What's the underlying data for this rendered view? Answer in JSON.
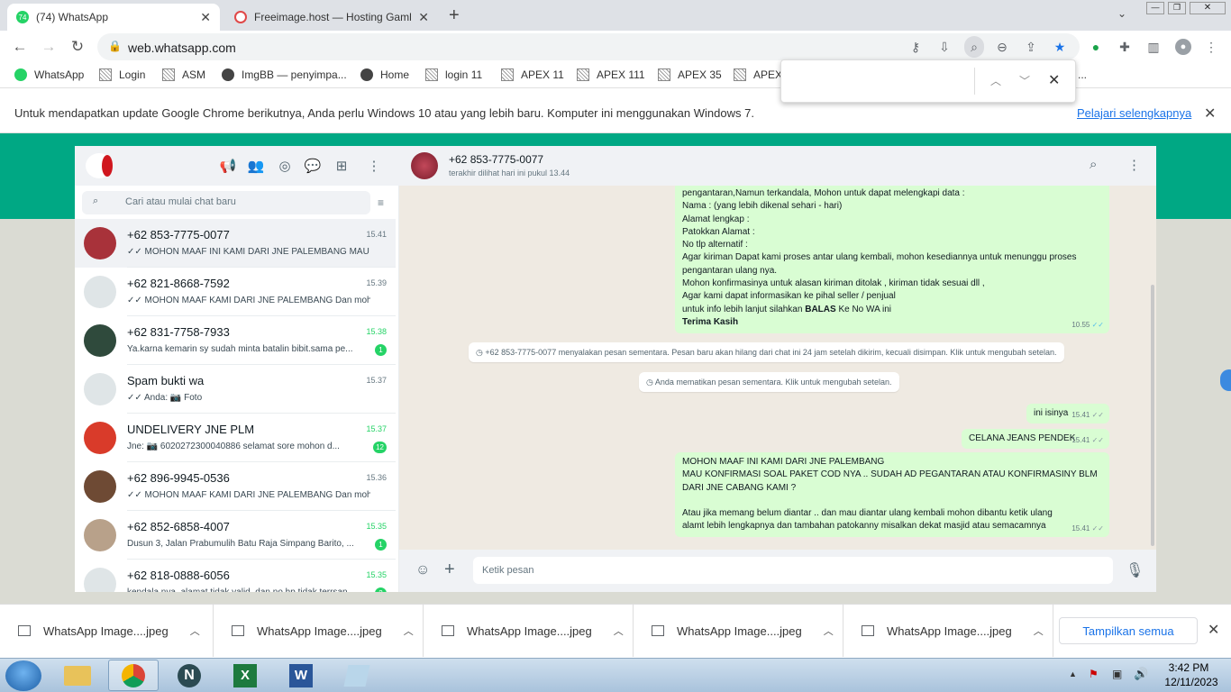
{
  "browser": {
    "tabs": [
      {
        "title": "(74) WhatsApp",
        "badge": "74"
      },
      {
        "title": "Freeimage.host — Hosting Gamb"
      }
    ],
    "url": "web.whatsapp.com",
    "bookmarks": [
      "WhatsApp",
      "Login",
      "ASM",
      "ImgBB — penyimpa...",
      "Home",
      "login 11",
      "APEX 11",
      "APEX 111",
      "APEX 35",
      "APEX"
    ],
    "bookmarks_more": "...",
    "infobar": {
      "message": "Untuk mendapatkan update Google Chrome berikutnya, Anda perlu Windows 10 atau yang lebih baru. Komputer ini menggunakan Windows 7.",
      "link": "Pelajari selengkapnya"
    }
  },
  "whatsapp": {
    "search_placeholder": "Cari atau mulai chat baru",
    "chats": [
      {
        "name": "+62 853-7775-0077",
        "time": "15.41",
        "preview": "✓✓ MOHON MAAF INI KAMI DARI JNE PALEMBANG MAU K...",
        "unread": "",
        "time_color": "#667781",
        "avatar": "#a8323a"
      },
      {
        "name": "+62 821-8668-7592",
        "time": "15.39",
        "preview": "✓✓ MOHON MAAF KAMI DARI JNE PALEMBANG   Dan moh...",
        "unread": "",
        "time_color": "#667781",
        "avatar": "#dfe5e7"
      },
      {
        "name": "+62 831-7758-7933",
        "time": "15.38",
        "preview": "Ya.karna kemarin sy sudah minta batalin bibit.sama pe...",
        "unread": "1",
        "time_color": "#25d366",
        "avatar": "#2f4a3c"
      },
      {
        "name": "Spam bukti wa",
        "time": "15.37",
        "preview": "✓✓ Anda: 📷 Foto",
        "unread": "",
        "time_color": "#667781",
        "avatar": "#dfe5e7"
      },
      {
        "name": "UNDELIVERY JNE PLM",
        "time": "15.37",
        "preview": "Jne: 📷 6020272300040886 selamat sore mohon d...",
        "unread": "12",
        "time_color": "#25d366",
        "avatar": "#d93b2a"
      },
      {
        "name": "+62 896-9945-0536",
        "time": "15.36",
        "preview": "✓✓ MOHON MAAF KAMI DARI JNE PALEMBANG   Dan moh...",
        "unread": "",
        "time_color": "#667781",
        "avatar": "#6e4a34"
      },
      {
        "name": "+62 852-6858-4007",
        "time": "15.35",
        "preview": "Dusun 3, Jalan Prabumulih Batu Raja Simpang Barito, ...",
        "unread": "1",
        "time_color": "#25d366",
        "avatar": "#b8a18a"
      },
      {
        "name": "+62 818-0888-6056",
        "time": "15.35",
        "preview": "kendala nya. alamat tidak valid. dan no hp tidak terrsan...",
        "unread": "2",
        "time_color": "#25d366",
        "avatar": "#dfe5e7"
      }
    ],
    "conversation": {
      "name": "+62 853-7775-0077",
      "status": "terakhir dilihat hari ini pukul 13.44",
      "first_message_lines": [
        "pengantaran,Namun terkandala, Mohon untuk dapat melengkapi data :",
        "Nama : (yang lebih dikenal sehari - hari)",
        "Alamat  lengkap :",
        "Patokkan Alamat :",
        "No tlp alternatif :",
        "Agar kiriman Dapat kami proses antar ulang kembali, mohon kesediannya untuk menunggu proses",
        "pengantaran ulang nya.",
        "Mohon konfirmasinya untuk alasan kiriman ditolak , kiriman tidak sesuai dll ,",
        "Agar kami dapat informasikan ke pihal seller / penjual",
        "untuk info lebih lanjut silahkan"
      ],
      "first_message_bold1": "BALAS",
      "first_message_tail": " Ke No WA ini",
      "first_message_bold2": "Terima Kasih",
      "first_message_time": "10.55",
      "system_1": "+62 853-7775-0077 menyalakan pesan sementara. Pesan baru akan hilang dari chat ini 24 jam setelah dikirim, kecuali disimpan. Klik untuk mengubah setelan.",
      "system_2": "Anda mematikan pesan sementara. Klik untuk mengubah setelan.",
      "msg_2": "ini isinya",
      "msg_2_time": "15.41",
      "msg_3": "CELANA JEANS PENDEK",
      "msg_3_time": "15.41",
      "msg_4_lines": [
        "MOHON MAAF INI KAMI DARI JNE PALEMBANG",
        "MAU KONFIRMASI  SOAL PAKET COD NYA .. SUDAH AD PEGANTARAN ATAU KONFIRMASINY BLM",
        "DARI JNE CABANG KAMI ?",
        "",
        "Atau  jika memang belum diantar .. dan mau diantar ulang   kembali mohon dibantu ketik ulang",
        "alamt lebih lengkapnya dan tambahan patokanny misalkan dekat masjid atau semacamnya"
      ],
      "msg_4_time": "15.41",
      "compose_placeholder": "Ketik pesan"
    }
  },
  "downloads": {
    "items": [
      "WhatsApp Image....jpeg",
      "WhatsApp Image....jpeg",
      "WhatsApp Image....jpeg",
      "WhatsApp Image....jpeg",
      "WhatsApp Image....jpeg"
    ],
    "show_all": "Tampilkan semua"
  },
  "taskbar": {
    "time": "3:42 PM",
    "date": "12/11/2023"
  },
  "colors": {
    "wa_green": "#00a884",
    "bubble": "#d9fdd3",
    "unread": "#25d366",
    "link": "#1a73e8"
  }
}
